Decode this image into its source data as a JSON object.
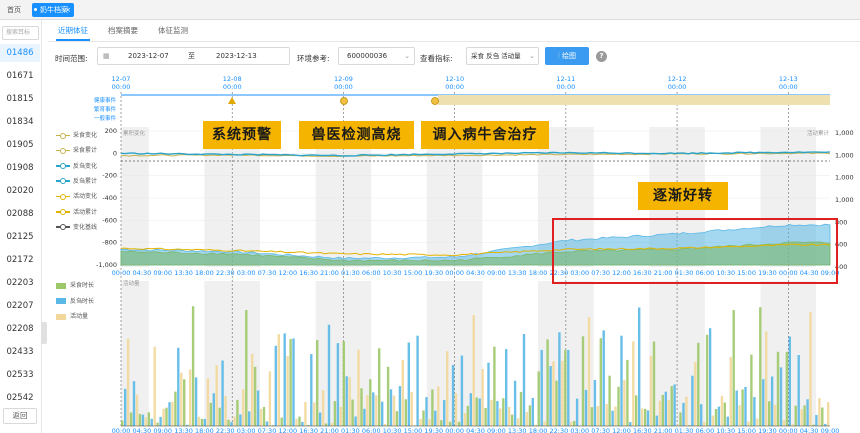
{
  "top_tabs": {
    "home": "首页",
    "active": "奶牛档案"
  },
  "sidebar": {
    "search_placeholder": "搜索耳标",
    "items": [
      "01486",
      "01671",
      "01815",
      "01834",
      "01905",
      "01908",
      "02020",
      "02088",
      "02125",
      "02172",
      "02203",
      "02207",
      "02208",
      "02433",
      "02533",
      "02542"
    ],
    "active_index": 0,
    "return_label": "返回"
  },
  "sub_tabs": [
    "近期体征",
    "档案摘要",
    "体征监测"
  ],
  "filters": {
    "time_range_label": "时间范围:",
    "date_start": "2023-12-07",
    "to_label": "至",
    "date_end": "2023-12-13",
    "env_label": "环境参考:",
    "env_value": "600000036",
    "indicator_label": "查看指标:",
    "indicator_value": "采食 反刍 活动量",
    "plot_button": "绘图",
    "help_icon": "?"
  },
  "legend_top": [
    {
      "label": "采食变化",
      "color": "#c9b14a"
    },
    {
      "label": "采食累计",
      "color": "#c9b14a"
    },
    {
      "label": "反刍变化",
      "color": "#29a3c9"
    },
    {
      "label": "反刍累计",
      "color": "#29a3c9"
    },
    {
      "label": "活动变化",
      "color": "#e0b400"
    },
    {
      "label": "活动累计",
      "color": "#e0b400"
    },
    {
      "label": "变化基线",
      "color": "#555555"
    }
  ],
  "legend_bottom": [
    {
      "label": "采食时长",
      "color": "#9dc86a"
    },
    {
      "label": "反刍时长",
      "color": "#5ab8e6"
    },
    {
      "label": "活动量",
      "color": "#f2d79a"
    }
  ],
  "timeline": {
    "dates": [
      "12-07",
      "12-08",
      "12-09",
      "12-10",
      "12-11",
      "12-12",
      "12-13"
    ],
    "date_time": "00:00",
    "event_rows": [
      "健康事件",
      "繁育事件",
      "一般事件"
    ]
  },
  "line_chart": {
    "left_axis_title": "累积变化",
    "right_axis_title": "活动累计",
    "left_ticks": [
      "200",
      "0",
      "-200",
      "-400",
      "-600",
      "-800",
      "-1,000"
    ],
    "right_ticks": [
      "1,000",
      "1,000",
      "1,000",
      "1,000",
      "800",
      "600",
      "400"
    ],
    "x_ticks": [
      "00:00",
      "04:30",
      "09:00",
      "13:30",
      "18:00",
      "22:30",
      "03:00",
      "07:30",
      "12:00",
      "16:30",
      "21:00",
      "01:30",
      "06:00",
      "10:30",
      "15:00",
      "19:30",
      "00:00",
      "04:30",
      "09:00",
      "13:30",
      "18:00",
      "22:30",
      "03:00",
      "07:30",
      "12:00",
      "16:30",
      "21:00",
      "01:30",
      "06:00",
      "10:30",
      "15:00",
      "19:30",
      "00:00",
      "04:30",
      "09:00"
    ]
  },
  "bar_chart": {
    "axis_title": "活动量"
  },
  "chart_data": [
    {
      "type": "line",
      "x": [
        "12-07",
        "12-08",
        "12-09",
        "12-10",
        "12-11",
        "12-12",
        "12-13"
      ],
      "series": [
        {
          "name": "采食变化",
          "values": [
            -20,
            -15,
            -25,
            -18,
            -10,
            -5,
            0
          ]
        },
        {
          "name": "反刍变化",
          "values": [
            0,
            -10,
            -20,
            -5,
            5,
            0,
            10
          ]
        },
        {
          "name": "采食累计",
          "values": [
            -880,
            -900,
            -960,
            -960,
            -880,
            -860,
            -800
          ]
        },
        {
          "name": "反刍累计",
          "values": [
            -860,
            -880,
            -940,
            -930,
            -780,
            -720,
            -640
          ]
        },
        {
          "name": "活动累计",
          "values": [
            -850,
            -870,
            -900,
            -910,
            -860,
            -850,
            -820
          ]
        }
      ],
      "ylim": [
        -1000,
        200
      ]
    },
    {
      "type": "bar",
      "series": [
        {
          "name": "采食时长"
        },
        {
          "name": "反刍时长"
        },
        {
          "name": "活动量"
        }
      ]
    }
  ],
  "annotations": {
    "alert": "系统预警",
    "fever": "兽医检测高烧",
    "transfer": "调入病牛舍治疗",
    "improve": "逐渐好转"
  }
}
